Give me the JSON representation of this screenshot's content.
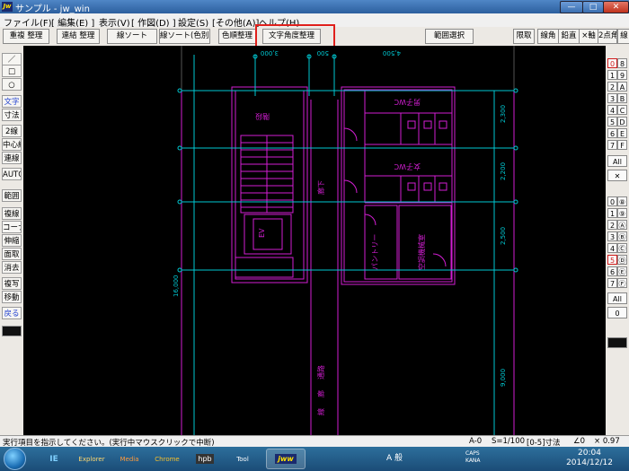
{
  "window": {
    "title": "サンプル - jw_win",
    "app_icon_text": "Jw",
    "minimize_glyph": "—",
    "maximize_glyph": "□",
    "close_glyph": "✕"
  },
  "menu": [
    "ファイル(F)",
    "[ 編集(E) ]",
    "表示(V)",
    "[ 作図(D) ]",
    "設定(S)",
    "[その他(A)]",
    "ヘルプ(H)"
  ],
  "toolbar": {
    "buttons": [
      "重複 整理",
      "連結 整理",
      "線ソート",
      "線ソート(色別)",
      "色順整理",
      "文字角度整理",
      "範囲選択",
      "限取",
      "線角",
      "鉛直",
      "×軸",
      "2点角",
      "線"
    ]
  },
  "left_tools": [
    "／",
    "□",
    "○",
    "文字",
    "寸法",
    "2線",
    "中心線",
    "連線",
    "AUTO",
    "範囲",
    "複線",
    "コーナー",
    "伸縮",
    "面取",
    "消去",
    "複写",
    "移動",
    "戻る"
  ],
  "right_layers": {
    "top_numbers": [
      "0",
      "1",
      "2",
      "3",
      "4",
      "5",
      "6",
      "7"
    ],
    "top_letters": [
      "8",
      "9",
      "A",
      "B",
      "C",
      "D",
      "E",
      "F"
    ],
    "all_label": "All",
    "x_label": "✕",
    "mid_left": [
      "0",
      "1",
      "2",
      "3",
      "4",
      "5",
      "6",
      "7"
    ],
    "mid_right": [
      "⑧",
      "⑨",
      "Ⓐ",
      "Ⓑ",
      "Ⓒ",
      "Ⓓ",
      "Ⓔ",
      "Ⓕ"
    ],
    "all_label2": "All",
    "zero_label": "0"
  },
  "drawing": {
    "dims_top": [
      "3,000",
      "500",
      "4,500"
    ],
    "dims_right": [
      "2,300",
      "2,200",
      "2,500",
      "9,000"
    ],
    "dim_left": "16,000",
    "room_labels": [
      "階段",
      "男子WC",
      "女子WC",
      "廊下",
      "EV",
      "パントリー",
      "空調機械室",
      "通路",
      "廊",
      "線"
    ]
  },
  "status": {
    "message": "実行項目を指示してください。(実行中マウスクリックで中断)",
    "layer": "A-0",
    "scale": "S=1/100",
    "dim_setting": "[0-5]寸法",
    "angle": "∠0",
    "zoom": "× 0.97"
  },
  "taskbar": {
    "items": [
      "IE",
      "Explorer",
      "Media",
      "Chrome",
      "hpb",
      "Tool",
      "jww"
    ],
    "tray_text": "A 般",
    "lang": "CAPS KANA",
    "time": "20:04",
    "date": "2014/12/12"
  },
  "colors": {
    "magenta": "#d21ed2",
    "cyan": "#00c8d2",
    "red_highlight": "#e0201c"
  }
}
